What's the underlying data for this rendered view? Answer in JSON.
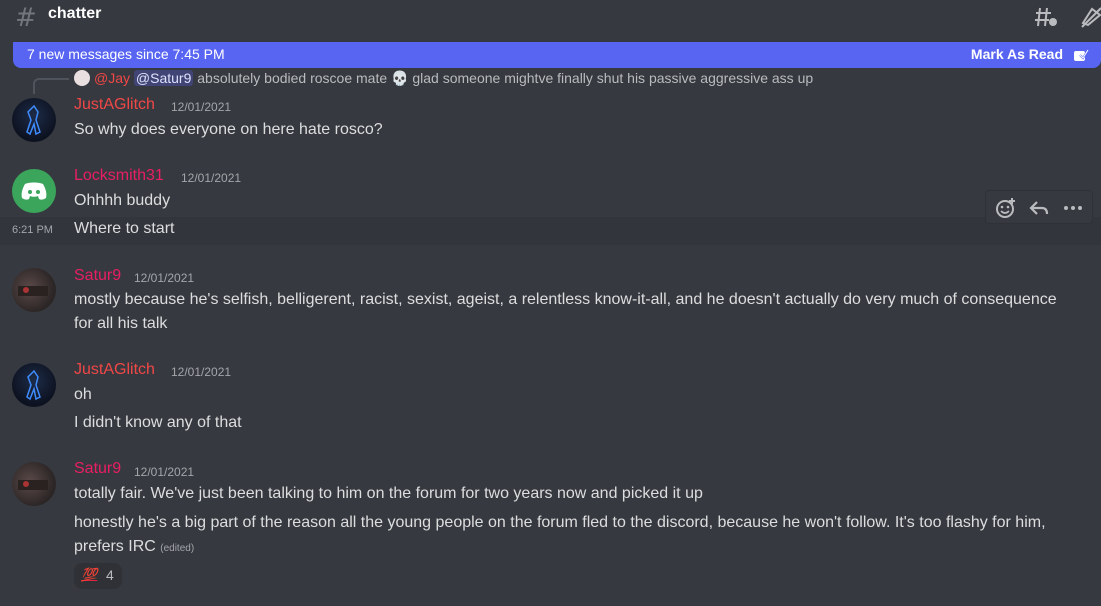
{
  "header": {
    "channel": "chatter",
    "hash": "#"
  },
  "new_messages_bar": {
    "text": "7 new messages since 7:45 PM",
    "mark_read": "Mark As Read"
  },
  "reply_preview": {
    "author": "@Jay",
    "mention": "@Satur9",
    "text": "absolutely bodied roscoe mate",
    "emoji": "💀",
    "text2": "glad someone mightve finally shut his passive aggressive ass up"
  },
  "messages": [
    {
      "author": "JustAGlitch",
      "timestamp": "12/01/2021",
      "lines": [
        "So why does everyone on here hate rosco?"
      ]
    },
    {
      "author": "Locksmith31",
      "timestamp": "12/01/2021",
      "lines": [
        "Ohhhh buddy",
        "Where to start"
      ],
      "hover_time": "6:21 PM"
    },
    {
      "author": "Satur9",
      "timestamp": "12/01/2021",
      "lines": [
        "mostly because he's selfish, belligerent, racist, sexist, ageist, a relentless know-it-all, and he doesn't actually do very much of consequence for all his talk"
      ]
    },
    {
      "author": "JustAGlitch",
      "timestamp": "12/01/2021",
      "lines": [
        "oh",
        "I didn't know any of that"
      ]
    },
    {
      "author": "Satur9",
      "timestamp": "12/01/2021",
      "lines": [
        "totally fair. We've just been talking to him on the forum for two years now and picked it up",
        "honestly he's a big part of the reason all the young people on the forum fled to the discord, because he won't follow. It's too flashy for him, prefers IRC"
      ],
      "edited": "(edited)",
      "reaction": {
        "emoji": "💯",
        "count": "4"
      }
    }
  ],
  "colors": {
    "accent": "#5865f2",
    "background": "#36393f",
    "username_red": "#f04747",
    "username_pink": "#e91e63"
  }
}
